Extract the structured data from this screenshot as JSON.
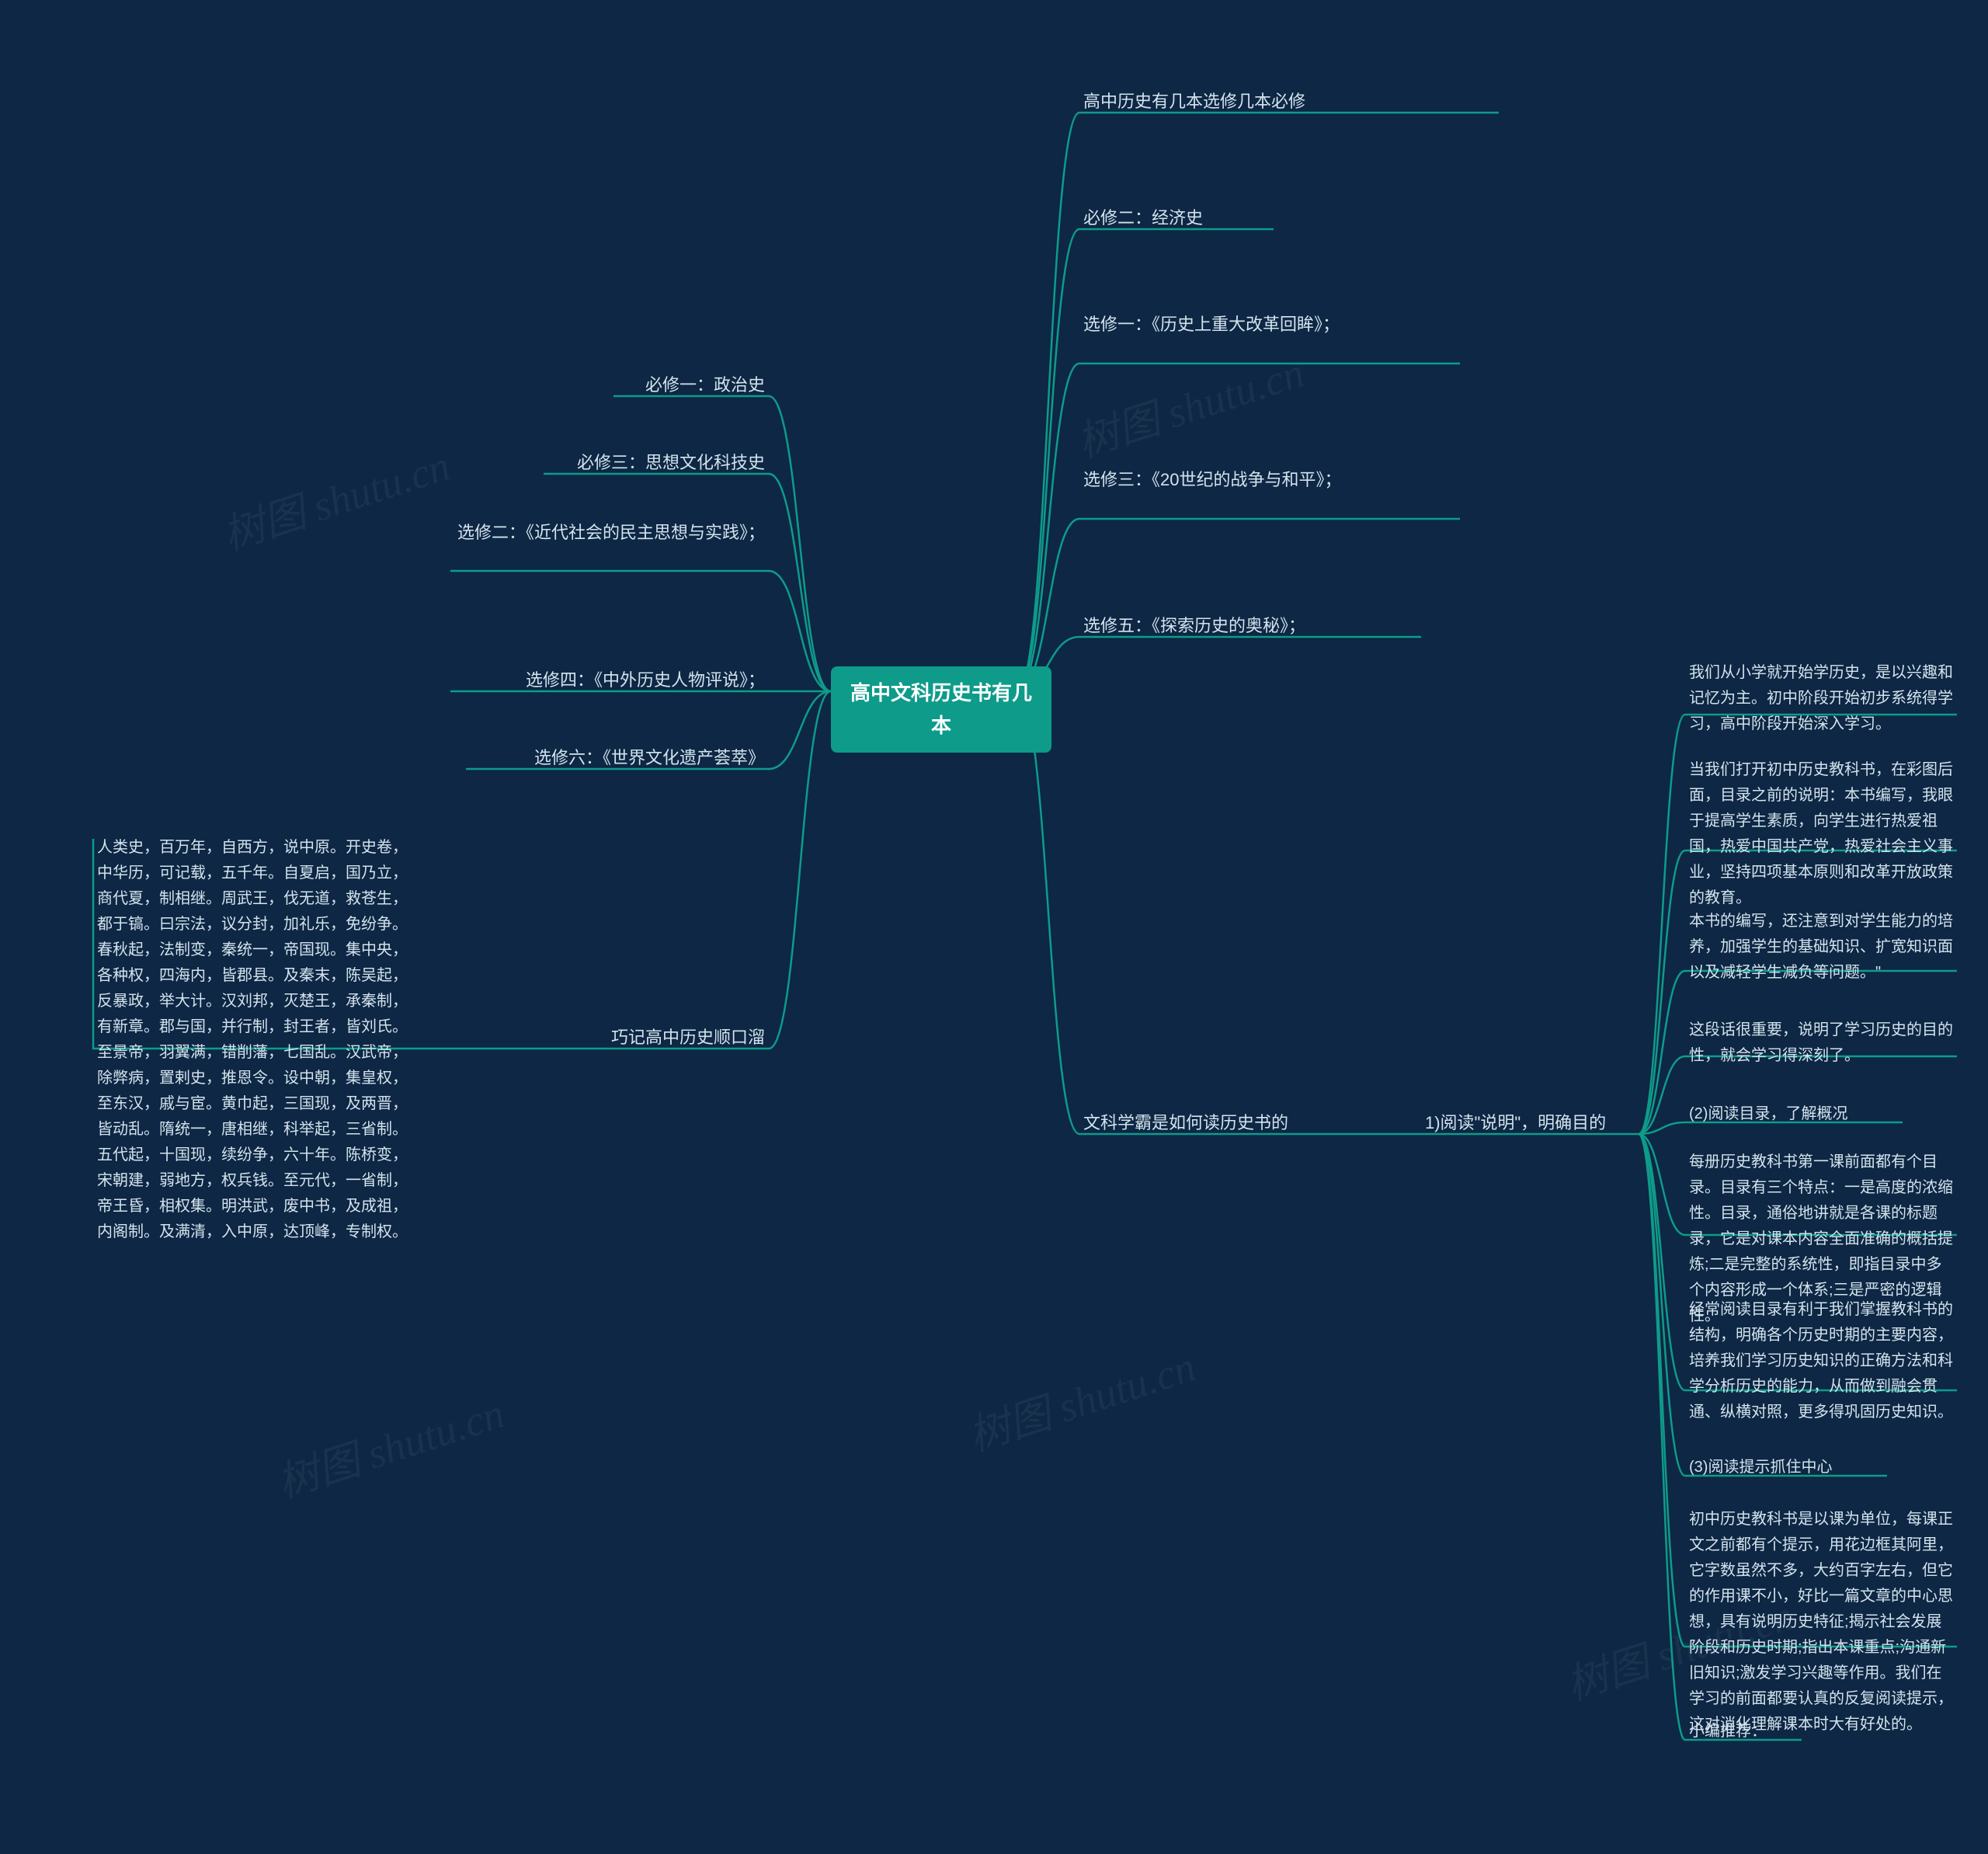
{
  "center": "高中文科历史书有几本",
  "left": {
    "l1": "必修一：政治史",
    "l2": "必修三：思想文化科技史",
    "l3": "选修二：《近代社会的民主思想与实践》；",
    "l4": "选修四：《中外历史人物评说》；",
    "l5": "选修六：《世界文化遗产荟萃》",
    "l6": "巧记高中历史顺口溜",
    "l6_text": "人类史，百万年，自西方，说中原。开史卷，\n中华历，可记载，五千年。自夏启，国乃立，\n商代夏，制相继。周武王，伐无道，救苍生，\n都于镐。曰宗法，议分封，加礼乐，免纷争。\n春秋起，法制变，秦统一，帝国现。集中央，\n各种权，四海内，皆郡县。及秦末，陈吴起，\n反暴政，举大计。汉刘邦，灭楚王，承秦制，\n有新章。郡与国，并行制，封王者，皆刘氏。\n至景帝，羽翼满，错削藩，七国乱。汉武帝，\n除弊病，置剌史，推恩令。设中朝，集皇权，\n至东汉，戚与宦。黄巾起，三国现，及两晋，\n皆动乱。隋统一，唐相继，科举起，三省制。\n五代起，十国现，续纷争，六十年。陈桥变，\n宋朝建，弱地方，权兵钱。至元代，一省制，\n帝王昏，相权集。明洪武，废中书，及成祖，\n内阁制。及满清，入中原，达顶峰，专制权。"
  },
  "right": {
    "r1": "高中历史有几本选修几本必修",
    "r2": "必修二：经济史",
    "r3": "选修一：《历史上重大改革回眸》；",
    "r4": "选修三：《20世纪的战争与和平》；",
    "r5": "选修五：《探索历史的奥秘》；",
    "r6": "文科学霸是如何读历史书的",
    "r6_sub": "1)阅读\"说明\"，明确目的",
    "details": {
      "d1": "我们从小学就开始学历史，是以兴趣和记忆为主。初中阶段开始初步系统得学习，高中阶段开始深入学习。",
      "d2": "当我们打开初中历史教科书，在彩图后面，目录之前的说明：本书编写，我眼于提高学生素质，向学生进行热爱祖国，热爱中国共产党，热爱社会主义事业，坚持四项基本原则和改革开放政策的教育。",
      "d3": "本书的编写，还注意到对学生能力的培养，加强学生的基础知识、扩宽知识面以及减轻学生减负等问题。\"",
      "d4": "这段话很重要，说明了学习历史的目的性，就会学习得深刻了。",
      "d5": "(2)阅读目录，了解概况",
      "d6": "每册历史教科书第一课前面都有个目录。目录有三个特点：一是高度的浓缩性。目录，通俗地讲就是各课的标题录，它是对课本内容全面准确的概括提炼;二是完整的系统性，即指目录中多个内容形成一个体系;三是严密的逻辑性。",
      "d7": "经常阅读目录有利于我们掌握教科书的结构，明确各个历史时期的主要内容，培养我们学习历史知识的正确方法和科学分析历史的能力，从而做到融会贯通、纵横对照，更多得巩固历史知识。",
      "d8": "(3)阅读提示抓住中心",
      "d9": "初中历史教科书是以课为单位，每课正文之前都有个提示，用花边框其阿里，它字数虽然不多，大约百字左右，但它的作用课不小，好比一篇文章的中心思想，具有说明历史特征;揭示社会发展阶段和历史时期;指出本课重点;沟通新旧知识;激发学习兴趣等作用。我们在学习的前面都要认真的反复阅读提示，这对消化理解课本时大有好处的。",
      "d10": "小编推荐："
    }
  },
  "watermark": "树图 shutu.cn"
}
